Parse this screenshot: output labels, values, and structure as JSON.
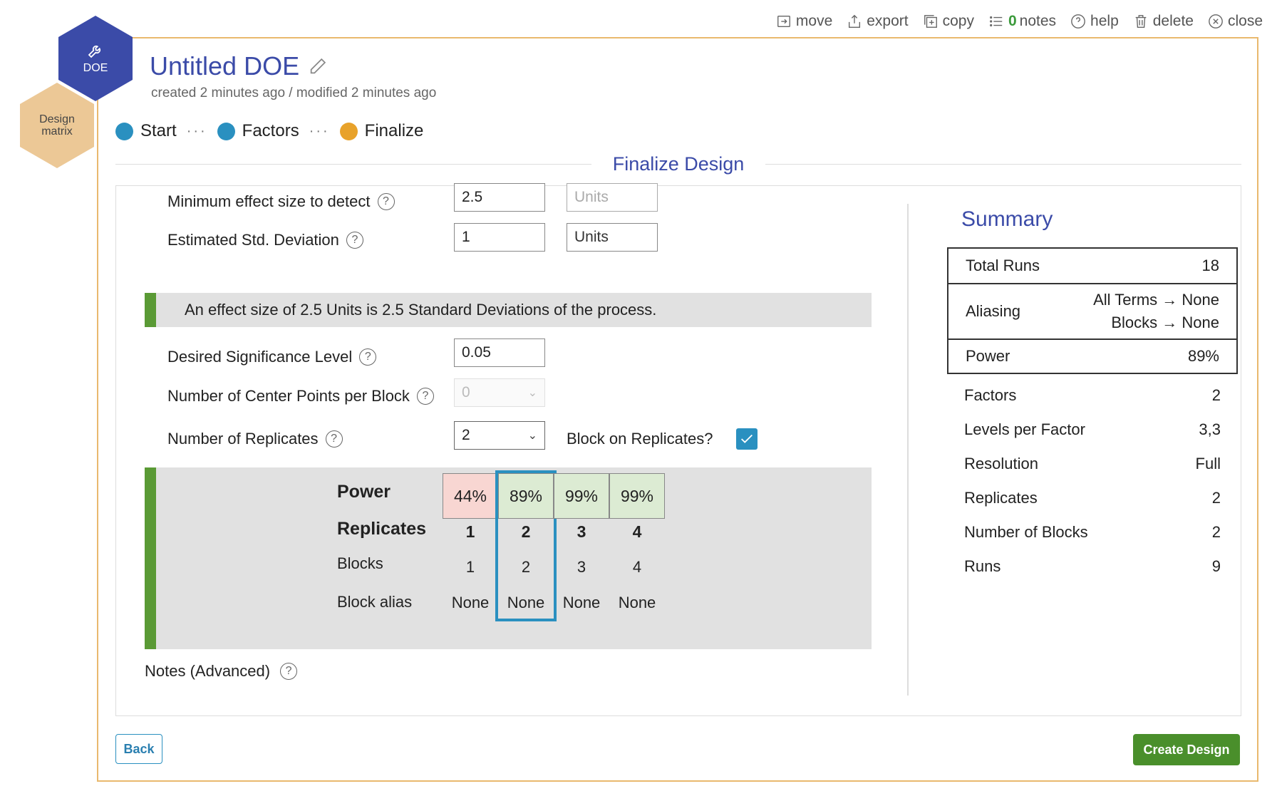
{
  "toolbar": {
    "move": "move",
    "export": "export",
    "copy": "copy",
    "notes_count": "0",
    "notes": "notes",
    "help": "help",
    "delete": "delete",
    "close": "close"
  },
  "hex": {
    "doe": "DOE",
    "matrix": "Design matrix"
  },
  "header": {
    "title": "Untitled DOE",
    "subtitle": "created 2 minutes ago / modified 2 minutes ago"
  },
  "steps": [
    {
      "label": "Start",
      "color": "#2a90c0"
    },
    {
      "label": "Factors",
      "color": "#2a90c0"
    },
    {
      "label": "Finalize",
      "color": "#e8a22a"
    }
  ],
  "step_separator": "···",
  "section_title": "Finalize Design",
  "form": {
    "min_effect": {
      "label": "Minimum effect size to detect",
      "value": "2.5",
      "units_placeholder": "Units"
    },
    "std_dev": {
      "label": "Estimated Std. Deviation",
      "value": "1",
      "units": "Units"
    },
    "info": "An effect size of 2.5 Units is 2.5 Standard Deviations of the process.",
    "significance": {
      "label": "Desired Significance Level",
      "value": "0.05"
    },
    "center_points": {
      "label": "Number of Center Points per Block",
      "value": "0"
    },
    "replicates": {
      "label": "Number of Replicates",
      "value": "2"
    },
    "block_on_replicates": {
      "label": "Block on Replicates?",
      "checked": true
    },
    "notes_label": "Notes (Advanced)"
  },
  "power_table": {
    "row_labels": {
      "power": "Power",
      "replicates": "Replicates",
      "blocks": "Blocks",
      "block_alias": "Block alias"
    },
    "columns": [
      {
        "power": "44%",
        "replicates": "1",
        "blocks": "1",
        "alias": "None",
        "color": "#f8d6d2"
      },
      {
        "power": "89%",
        "replicates": "2",
        "blocks": "2",
        "alias": "None",
        "color": "#dcebd3"
      },
      {
        "power": "99%",
        "replicates": "3",
        "blocks": "3",
        "alias": "None",
        "color": "#dcebd3"
      },
      {
        "power": "99%",
        "replicates": "4",
        "blocks": "4",
        "alias": "None",
        "color": "#dcebd3"
      }
    ],
    "selected_index": 1
  },
  "summary": {
    "title": "Summary",
    "total_runs": {
      "label": "Total Runs",
      "value": "18"
    },
    "aliasing": {
      "label": "Aliasing",
      "line1": "All Terms → None",
      "line2": "Blocks → None"
    },
    "power": {
      "label": "Power",
      "value": "89%"
    },
    "list": [
      {
        "label": "Factors",
        "value": "2"
      },
      {
        "label": "Levels per Factor",
        "value": "3,3"
      },
      {
        "label": "Resolution",
        "value": "Full"
      },
      {
        "label": "Replicates",
        "value": "2"
      },
      {
        "label": "Number of Blocks",
        "value": "2"
      },
      {
        "label": "Runs",
        "value": "9"
      }
    ]
  },
  "buttons": {
    "back": "Back",
    "create": "Create Design"
  },
  "colors": {
    "accent": "#3b4ba8",
    "blue": "#2a90c0",
    "green": "#5a9a35",
    "frame": "#e9b96e",
    "create": "#4a8f2b"
  }
}
